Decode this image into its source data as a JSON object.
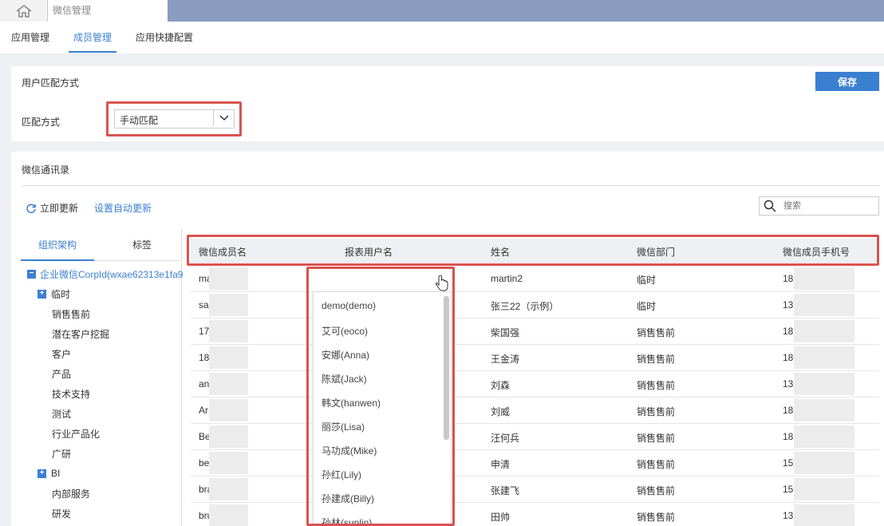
{
  "topbar": {
    "tab_title": "微信管理"
  },
  "subnav": {
    "items": [
      "应用管理",
      "成员管理",
      "应用快捷配置"
    ],
    "active_index": 1
  },
  "match_section": {
    "title": "用户匹配方式",
    "save_label": "保存",
    "field_label": "匹配方式",
    "select_value": "手动匹配"
  },
  "contacts_section": {
    "title": "微信通讯录",
    "refresh_label": "立即更新",
    "auto_update_label": "设置自动更新",
    "search_placeholder": "搜索"
  },
  "tree": {
    "tabs": [
      "组织架构",
      "标签"
    ],
    "root": "企业微信CorpId(wxae62313e1fa9",
    "nodes": [
      {
        "label": "临时",
        "expandable": true
      },
      {
        "label": "销售售前",
        "expandable": false
      },
      {
        "label": "潜在客户挖掘",
        "expandable": false
      },
      {
        "label": "客户",
        "expandable": false
      },
      {
        "label": "产品",
        "expandable": false
      },
      {
        "label": "技术支持",
        "expandable": false
      },
      {
        "label": "测试",
        "expandable": false
      },
      {
        "label": "行业产品化",
        "expandable": false
      },
      {
        "label": "广研",
        "expandable": false
      },
      {
        "label": "BI",
        "expandable": true
      },
      {
        "label": "内部服务",
        "expandable": false
      },
      {
        "label": "研发",
        "expandable": false
      }
    ]
  },
  "table": {
    "headers": [
      "微信成员名",
      "报表用户名",
      "姓名",
      "微信部门",
      "微信成员手机号"
    ],
    "rows": [
      {
        "member": "ma",
        "name": "martin2",
        "dept": "临时",
        "phone": "18"
      },
      {
        "member": "sa",
        "name": "张三22（示例）",
        "dept": "临时",
        "phone": "13"
      },
      {
        "member": "17",
        "name": "柴国强",
        "dept": "销售售前",
        "phone": "18"
      },
      {
        "member": "18",
        "name": "王金涛",
        "dept": "销售售前",
        "phone": "18"
      },
      {
        "member": "an",
        "name": "刘森",
        "dept": "销售售前",
        "phone": "13"
      },
      {
        "member": "Ar",
        "name": "刘威",
        "dept": "销售售前",
        "phone": "18"
      },
      {
        "member": "Be",
        "name": "汪何兵",
        "dept": "销售售前",
        "phone": "18"
      },
      {
        "member": "be",
        "name": "申清",
        "dept": "销售售前",
        "phone": "15"
      },
      {
        "member": "bra",
        "name": "张建飞",
        "dept": "销售售前",
        "phone": "15"
      },
      {
        "member": "bru",
        "name": "田帅",
        "dept": "销售售前",
        "phone": "13"
      }
    ]
  },
  "dropdown": {
    "options": [
      "demo(demo)",
      "艾可(eoco)",
      "安娜(Anna)",
      "陈斌(Jack)",
      "韩文(hanwen)",
      "丽莎(Lisa)",
      "马功成(Mike)",
      "孙红(Lily)",
      "孙建成(Billy)",
      "孙林(sunlin)"
    ]
  },
  "colors": {
    "accent": "#3b7fd1",
    "highlight": "#d9534f",
    "topbar": "#8a9cc0"
  }
}
